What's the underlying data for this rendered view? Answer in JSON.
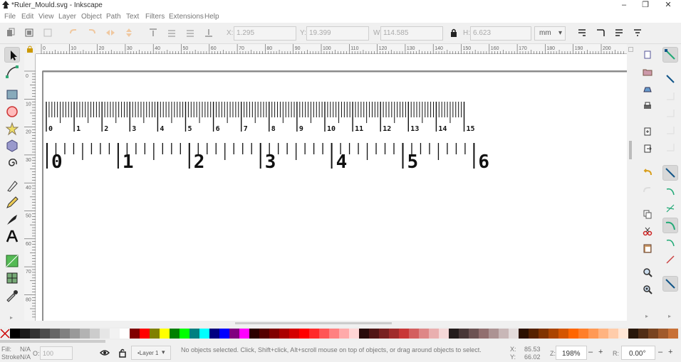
{
  "window": {
    "title": "*Ruler_Mould.svg - Inkscape",
    "minimize": "–",
    "maximize": "❐",
    "close": "✕"
  },
  "menu": [
    "File",
    "Edit",
    "View",
    "Layer",
    "Object",
    "Path",
    "Text",
    "Filters",
    "Extensions",
    "Help"
  ],
  "toolbar": {
    "x_label": "X:",
    "x_value": "1.295",
    "y_label": "Y:",
    "y_value": "19.399",
    "w_label": "W:",
    "w_value": "114.585",
    "h_label": "H:",
    "h_value": "6.623",
    "unit": "mm",
    "minus": "–",
    "plus": "+"
  },
  "hruler_labels": [
    "0",
    "10",
    "20",
    "30",
    "40",
    "50",
    "60",
    "70",
    "80",
    "90",
    "100",
    "110",
    "120",
    "130",
    "140",
    "150",
    "160",
    "170",
    "180",
    "190",
    "200",
    "210",
    "220"
  ],
  "vruler_labels": [
    "0",
    "10",
    "20",
    "30",
    "40",
    "50",
    "60",
    "70",
    "80",
    "90"
  ],
  "canvas": {
    "small_ruler_numbers": [
      "0",
      "1",
      "2",
      "3",
      "4",
      "5",
      "6",
      "7",
      "8",
      "9",
      "10",
      "11",
      "12",
      "13",
      "14",
      "15"
    ],
    "large_ruler_numbers": [
      "0",
      "1",
      "2",
      "3",
      "4",
      "5",
      "6"
    ]
  },
  "colors": {
    "palette": [
      "#000000",
      "#1a1a1a",
      "#333333",
      "#4d4d4d",
      "#666666",
      "#808080",
      "#999999",
      "#b3b3b3",
      "#cccccc",
      "#e6e6e6",
      "#f2f2f2",
      "#ffffff",
      "#800000",
      "#ff0000",
      "#808000",
      "#ffff00",
      "#008000",
      "#00ff00",
      "#008080",
      "#00ffff",
      "#000080",
      "#0000ff",
      "#800080",
      "#ff00ff",
      "#2b0000",
      "#550000",
      "#800000",
      "#aa0000",
      "#d40000",
      "#ff0000",
      "#ff2a2a",
      "#ff5555",
      "#ff8080",
      "#ffaaaa",
      "#ffd5d5",
      "#280b0b",
      "#501616",
      "#782121",
      "#a02c2c",
      "#c83737",
      "#d35f5f",
      "#de8787",
      "#e9afaf",
      "#f4d7d7",
      "#241c1c",
      "#483737",
      "#6c5353",
      "#916f6f",
      "#ac9393",
      "#c8b7b7",
      "#e3dbdb",
      "#2b1100",
      "#552200",
      "#803300",
      "#aa4400",
      "#d45500",
      "#ff6600",
      "#ff7f2a",
      "#ff9955",
      "#ffb380",
      "#ffccaa",
      "#ffe6d5",
      "#28170b",
      "#502d16",
      "#784421",
      "#a05a2c",
      "#c87137"
    ]
  },
  "status": {
    "fill_label": "Fill:",
    "fill_value": "N/A",
    "stroke_label": "Stroke:",
    "stroke_value": "N/A",
    "opacity_label": "O:",
    "opacity_value": "100",
    "layer": "•Layer 1",
    "message": "No objects selected. Click, Shift+click, Alt+scroll mouse on top of objects, or drag around objects to select.",
    "x_label": "X:",
    "x_value": "85.53",
    "y_label": "Y:",
    "y_value": "66.02",
    "z_label": "Z:",
    "zoom": "198%",
    "r_label": "R:",
    "rotation": "0.00°"
  }
}
